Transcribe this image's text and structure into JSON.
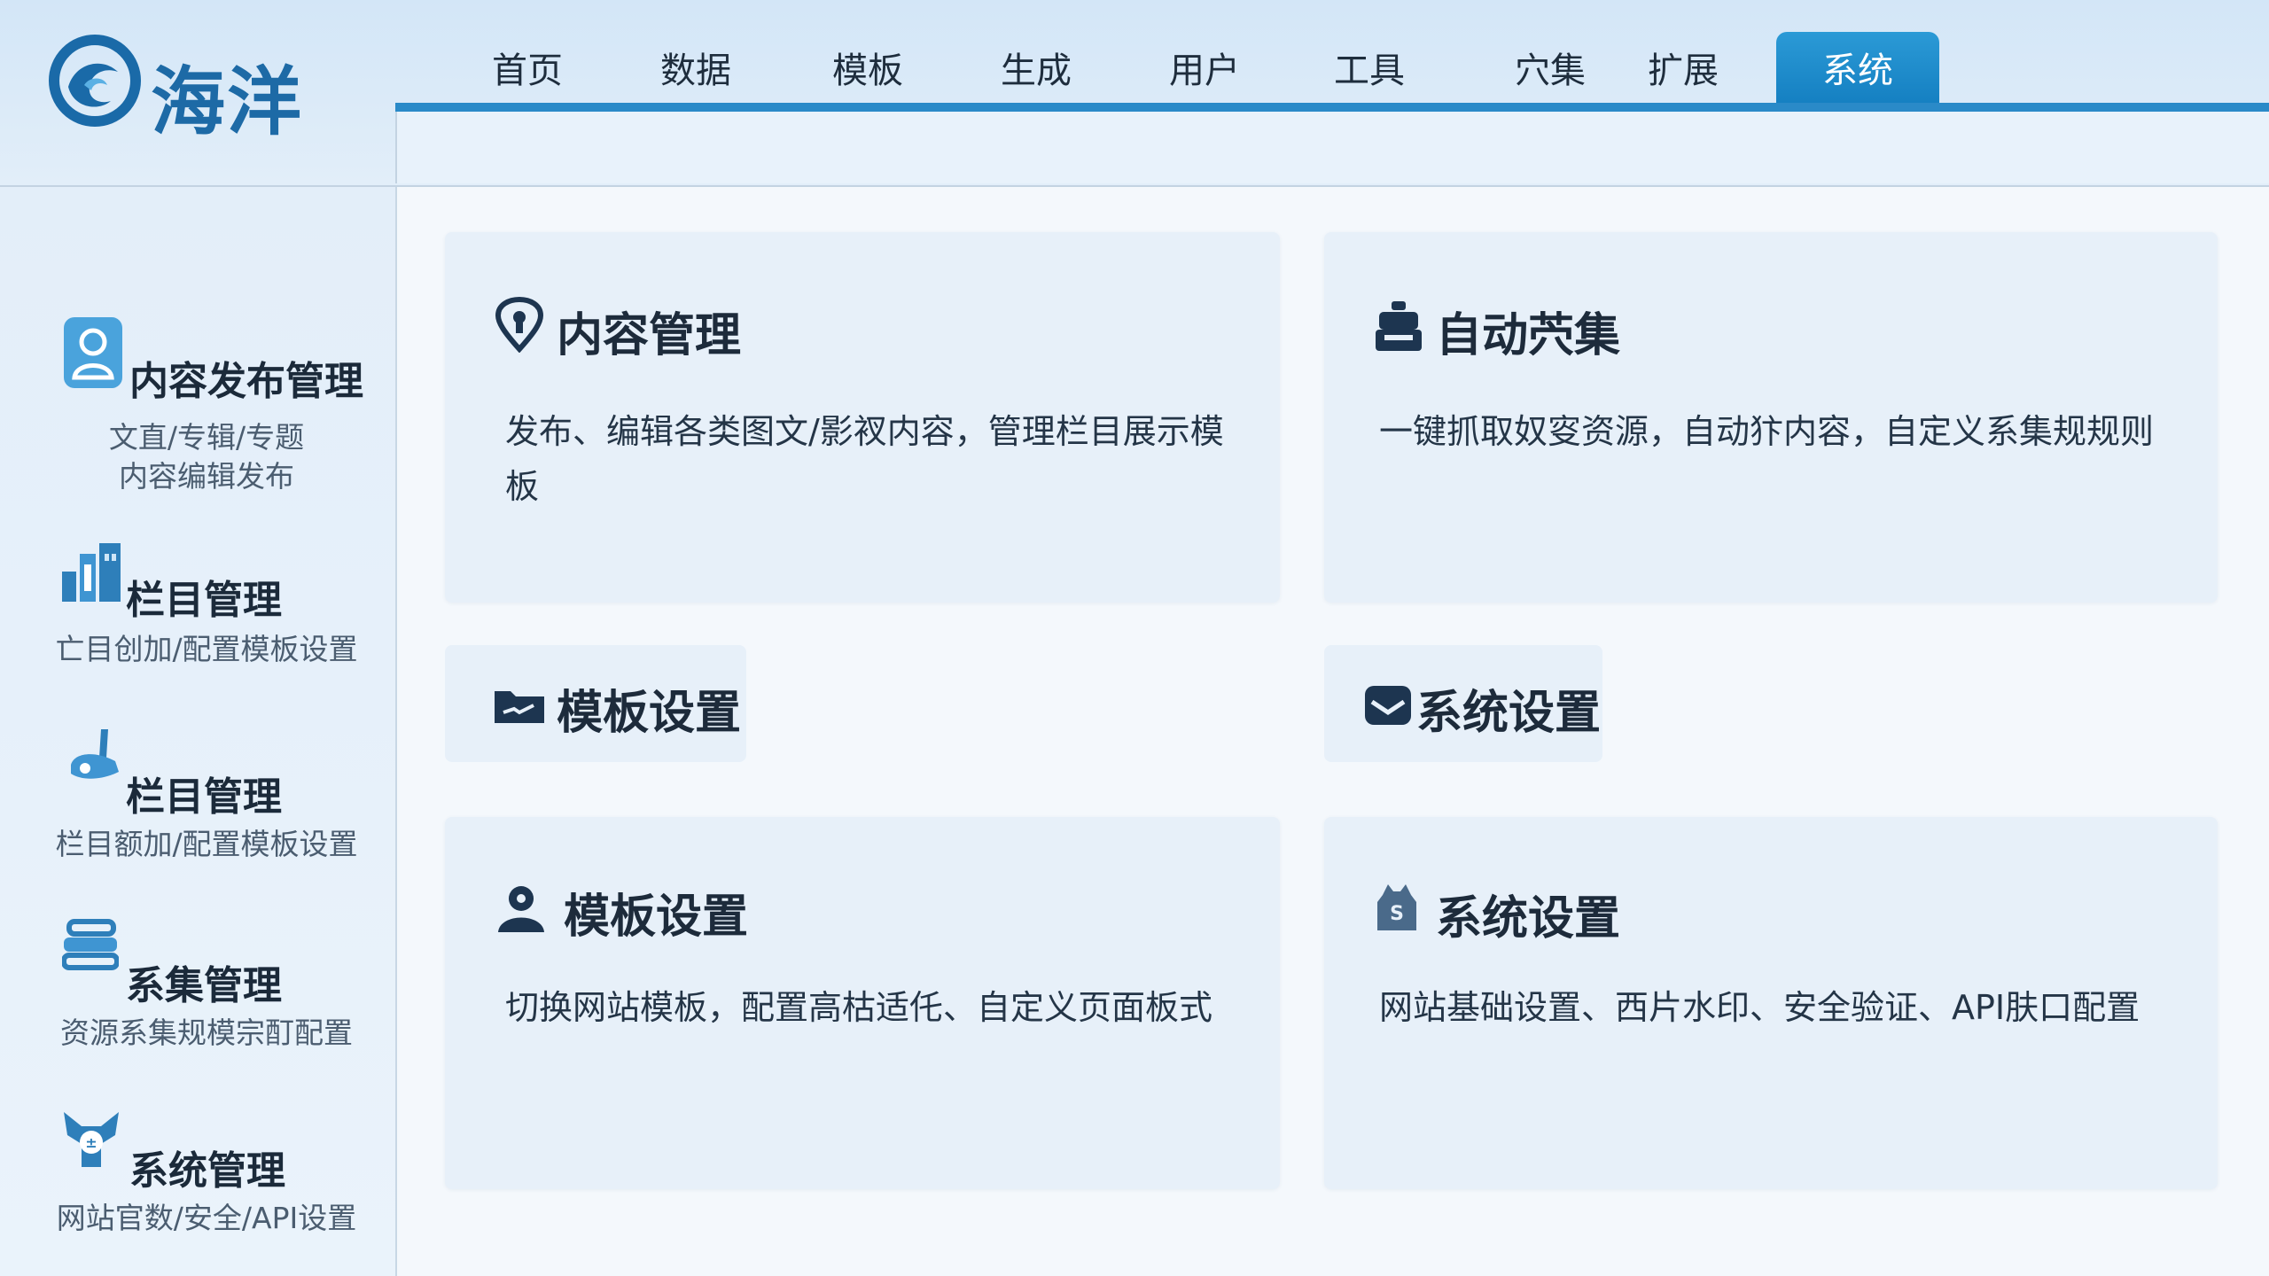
{
  "brand": {
    "name": "海洋",
    "logo_icon": "wave-logo-icon"
  },
  "nav": {
    "items": [
      {
        "label": "首页",
        "active": false
      },
      {
        "label": "数据",
        "active": false
      },
      {
        "label": "模板",
        "active": false
      },
      {
        "label": "生成",
        "active": false
      },
      {
        "label": "用户",
        "active": false
      },
      {
        "label": "工具",
        "active": false
      },
      {
        "label": "穴集",
        "active": false
      },
      {
        "label": "扩展",
        "active": false
      },
      {
        "label": "系统",
        "active": true
      }
    ],
    "active_color": "#1f8ccd"
  },
  "sidebar": {
    "items": [
      {
        "title": "内容发布管理",
        "desc_line1": "文直/专辑/专题",
        "desc_line2": "内容编辑发布",
        "icon": "user-badge-icon"
      },
      {
        "title": "栏目管理",
        "desc_line1": "亡目创加/配置模板设置",
        "icon": "buildings-icon"
      },
      {
        "title": "栏目管理",
        "desc_line1": "栏目额加/配置模板设置",
        "icon": "pen-tool-icon"
      },
      {
        "title": "系集管理",
        "desc_line1": "资源系集规模宗酊配置",
        "icon": "layers-icon"
      },
      {
        "title": "系统管理",
        "desc_line1": "网站官数/安全/API设置",
        "icon": "system-badge-icon"
      }
    ]
  },
  "cards": {
    "content_management": {
      "title": "内容管理",
      "desc": "发布、编辑各类图文/影衩内容，管理栏目展示模板",
      "icon": "location-pin-icon"
    },
    "auto_collect": {
      "title": "自动茓集",
      "desc": "一键抓取奴叜资源，自动犿内容，自定义系集规规则",
      "icon": "robot-icon"
    },
    "template_settings_header": {
      "title": "模板设置",
      "icon": "folder-icon"
    },
    "system_settings_header": {
      "title": "系统设置",
      "icon": "shield-envelope-icon"
    },
    "template_settings": {
      "title": "模板设置",
      "desc": "切换网站模板，配置高枯适仛、自定义页面板式",
      "icon": "user-icon"
    },
    "system_settings": {
      "title": "系统设置",
      "desc": "网站基础设置、西片水印、安全验证、API肤口配置",
      "icon": "bag-icon"
    }
  }
}
